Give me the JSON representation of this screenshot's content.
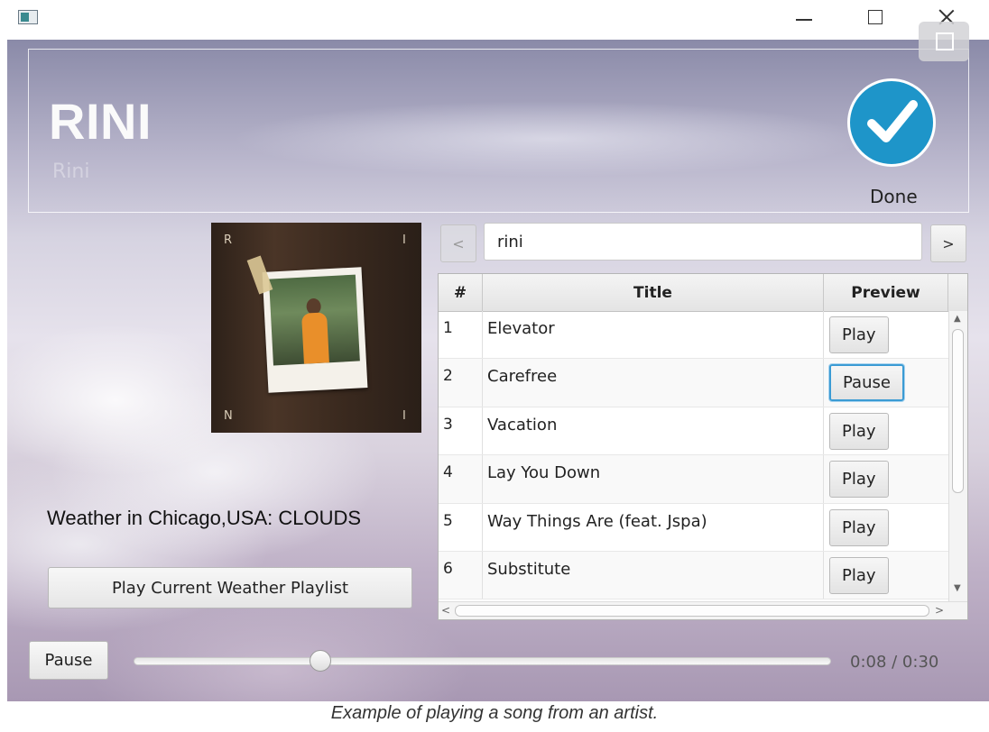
{
  "artist": {
    "name": "RINI",
    "subtitle": "Rini"
  },
  "done": {
    "label": "Done",
    "color": "#1e95c9"
  },
  "album": {
    "letters": [
      "R",
      "I",
      "N",
      "I"
    ]
  },
  "search": {
    "value": "rini",
    "prev": "<",
    "next": ">"
  },
  "table": {
    "headers": {
      "num": "#",
      "title": "Title",
      "preview": "Preview"
    },
    "rows": [
      {
        "num": "1",
        "title": "Elevator",
        "action": "Play"
      },
      {
        "num": "2",
        "title": "Carefree",
        "action": "Pause"
      },
      {
        "num": "3",
        "title": "Vacation",
        "action": "Play"
      },
      {
        "num": "4",
        "title": "Lay You Down",
        "action": "Play"
      },
      {
        "num": "5",
        "title": "Way Things Are (feat. Jspa)",
        "action": "Play"
      },
      {
        "num": "6",
        "title": "Substitute",
        "action": "Play"
      }
    ]
  },
  "weather": {
    "text": "Weather in Chicago,USA: CLOUDS",
    "button": "Play Current Weather Playlist"
  },
  "player": {
    "pause_label": "Pause",
    "time": "0:08  / 0:30",
    "progress": 0.27
  },
  "caption": "Example of playing a song from an artist."
}
